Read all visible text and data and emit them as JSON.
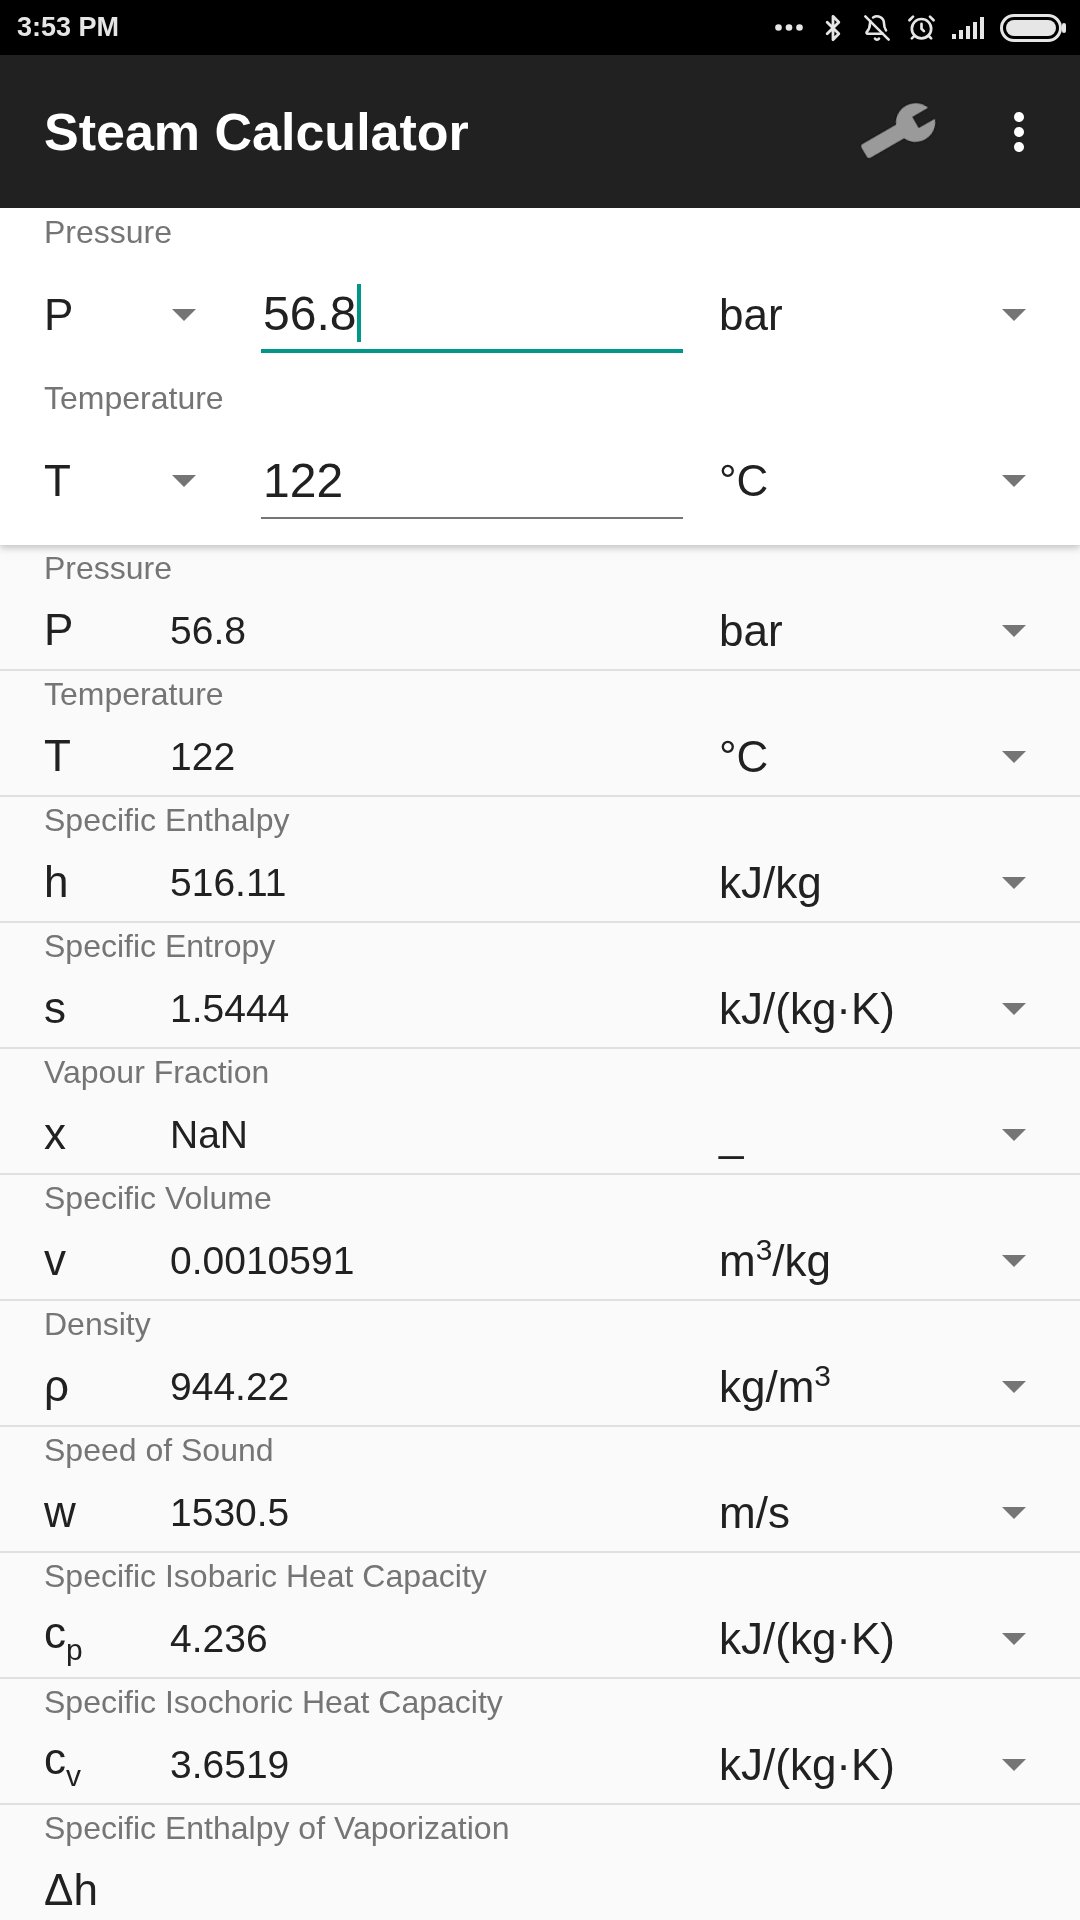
{
  "status_bar": {
    "time": "3:53 PM"
  },
  "app_bar": {
    "title": "Steam Calculator"
  },
  "inputs": [
    {
      "label": "Pressure",
      "symbol": "P",
      "value": "56.8",
      "unit": "bar",
      "focused": true
    },
    {
      "label": "Temperature",
      "symbol": "T",
      "value": "122",
      "unit": "°C",
      "focused": false
    }
  ],
  "results": [
    {
      "label": "Pressure",
      "symbol": "P",
      "value": "56.8",
      "unit": "bar"
    },
    {
      "label": "Temperature",
      "symbol": "T",
      "value": "122",
      "unit": "°C"
    },
    {
      "label": "Specific Enthalpy",
      "symbol": "h",
      "value": "516.11",
      "unit": "kJ/kg"
    },
    {
      "label": "Specific Entropy",
      "symbol": "s",
      "value": "1.5444",
      "unit": "kJ/(kg·K)"
    },
    {
      "label": "Vapour Fraction",
      "symbol": "x",
      "value": "NaN",
      "unit": "_"
    },
    {
      "label": "Specific Volume",
      "symbol": "v",
      "value": "0.0010591",
      "unit": "m$^{3}$/kg"
    },
    {
      "label": "Density",
      "symbol": "ρ",
      "value": "944.22",
      "unit": "kg/m$^{3}$"
    },
    {
      "label": "Speed of Sound",
      "symbol": "w",
      "value": "1530.5",
      "unit": "m/s"
    },
    {
      "label": "Specific Isobaric Heat Capacity",
      "symbol": "c$_{p}$",
      "value": "4.236",
      "unit": "kJ/(kg·K)"
    },
    {
      "label": "Specific Isochoric Heat Capacity",
      "symbol": "c$_{v}$",
      "value": "3.6519",
      "unit": "kJ/(kg·K)"
    },
    {
      "label": "Specific Enthalpy of Vaporization",
      "symbol": "Δh"
    }
  ]
}
